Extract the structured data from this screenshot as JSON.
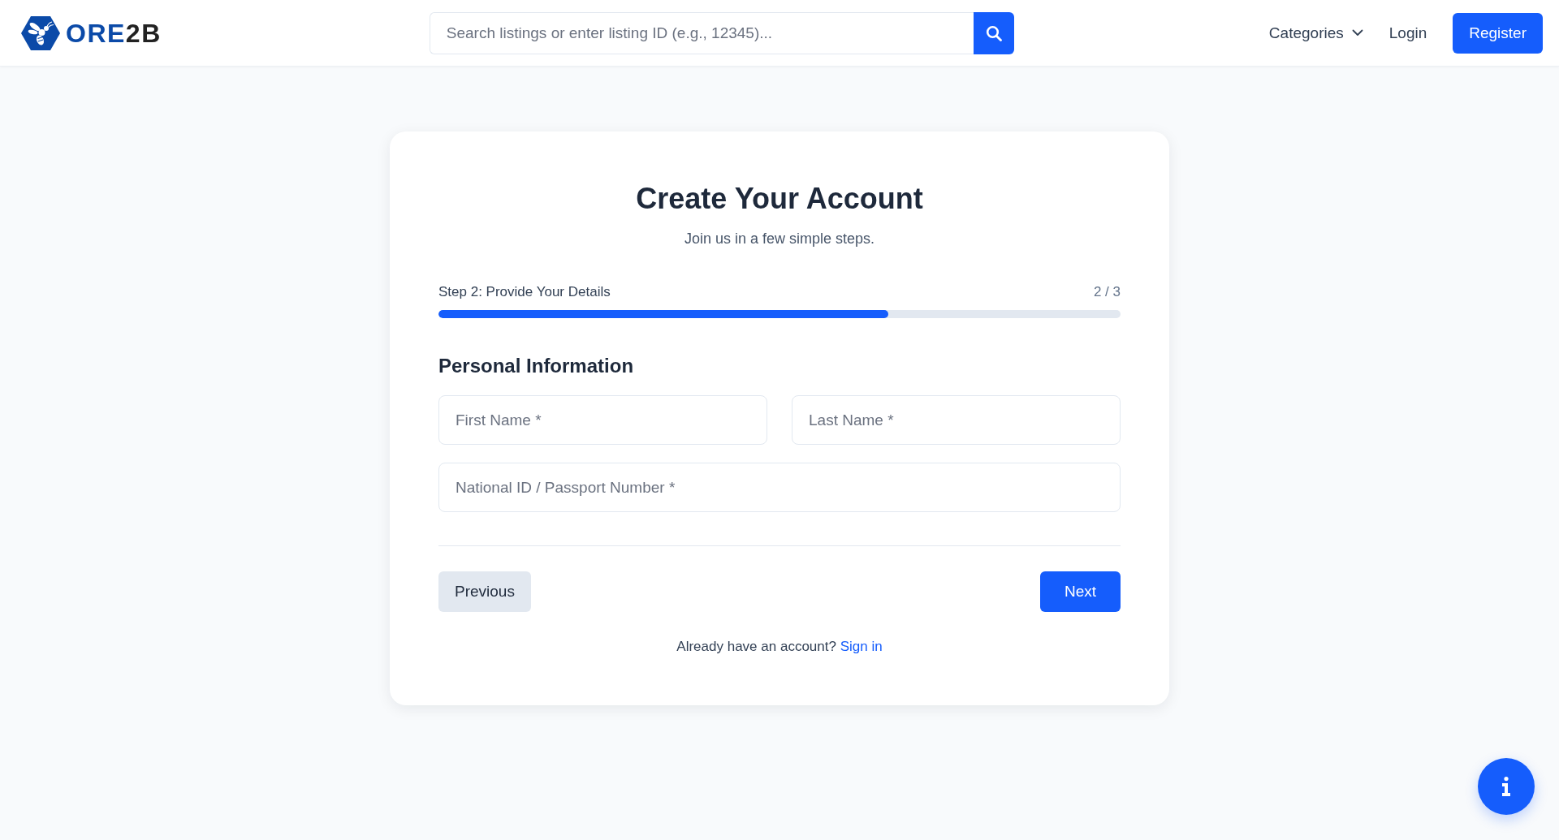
{
  "header": {
    "logo": {
      "text_parts": [
        "ORE",
        "2B"
      ]
    },
    "search": {
      "placeholder": "Search listings or enter listing ID (e.g., 12345)..."
    },
    "nav": [
      {
        "kind": "dropdown",
        "label": "Categories"
      },
      {
        "kind": "link",
        "label": "Login"
      },
      {
        "kind": "button",
        "label": "Register"
      }
    ]
  },
  "card": {
    "title": "Create Your Account",
    "subtitle": "Join us in a few simple steps.",
    "progress": {
      "label": "Step 2: Provide Your Details",
      "count": "2 / 3",
      "level": 0.66
    },
    "section_title": "Personal Information",
    "fields": [
      [
        {
          "placeholder": "First Name *"
        },
        {
          "placeholder": "Last Name *"
        }
      ],
      [
        {
          "placeholder": "National ID / Passport Number *"
        }
      ]
    ],
    "buttons": [
      {
        "kind": "secondary",
        "label": "Previous"
      },
      {
        "kind": "primary",
        "label": "Next"
      }
    ],
    "footer": {
      "text": "Already have an account?",
      "link": "Sign in"
    }
  }
}
